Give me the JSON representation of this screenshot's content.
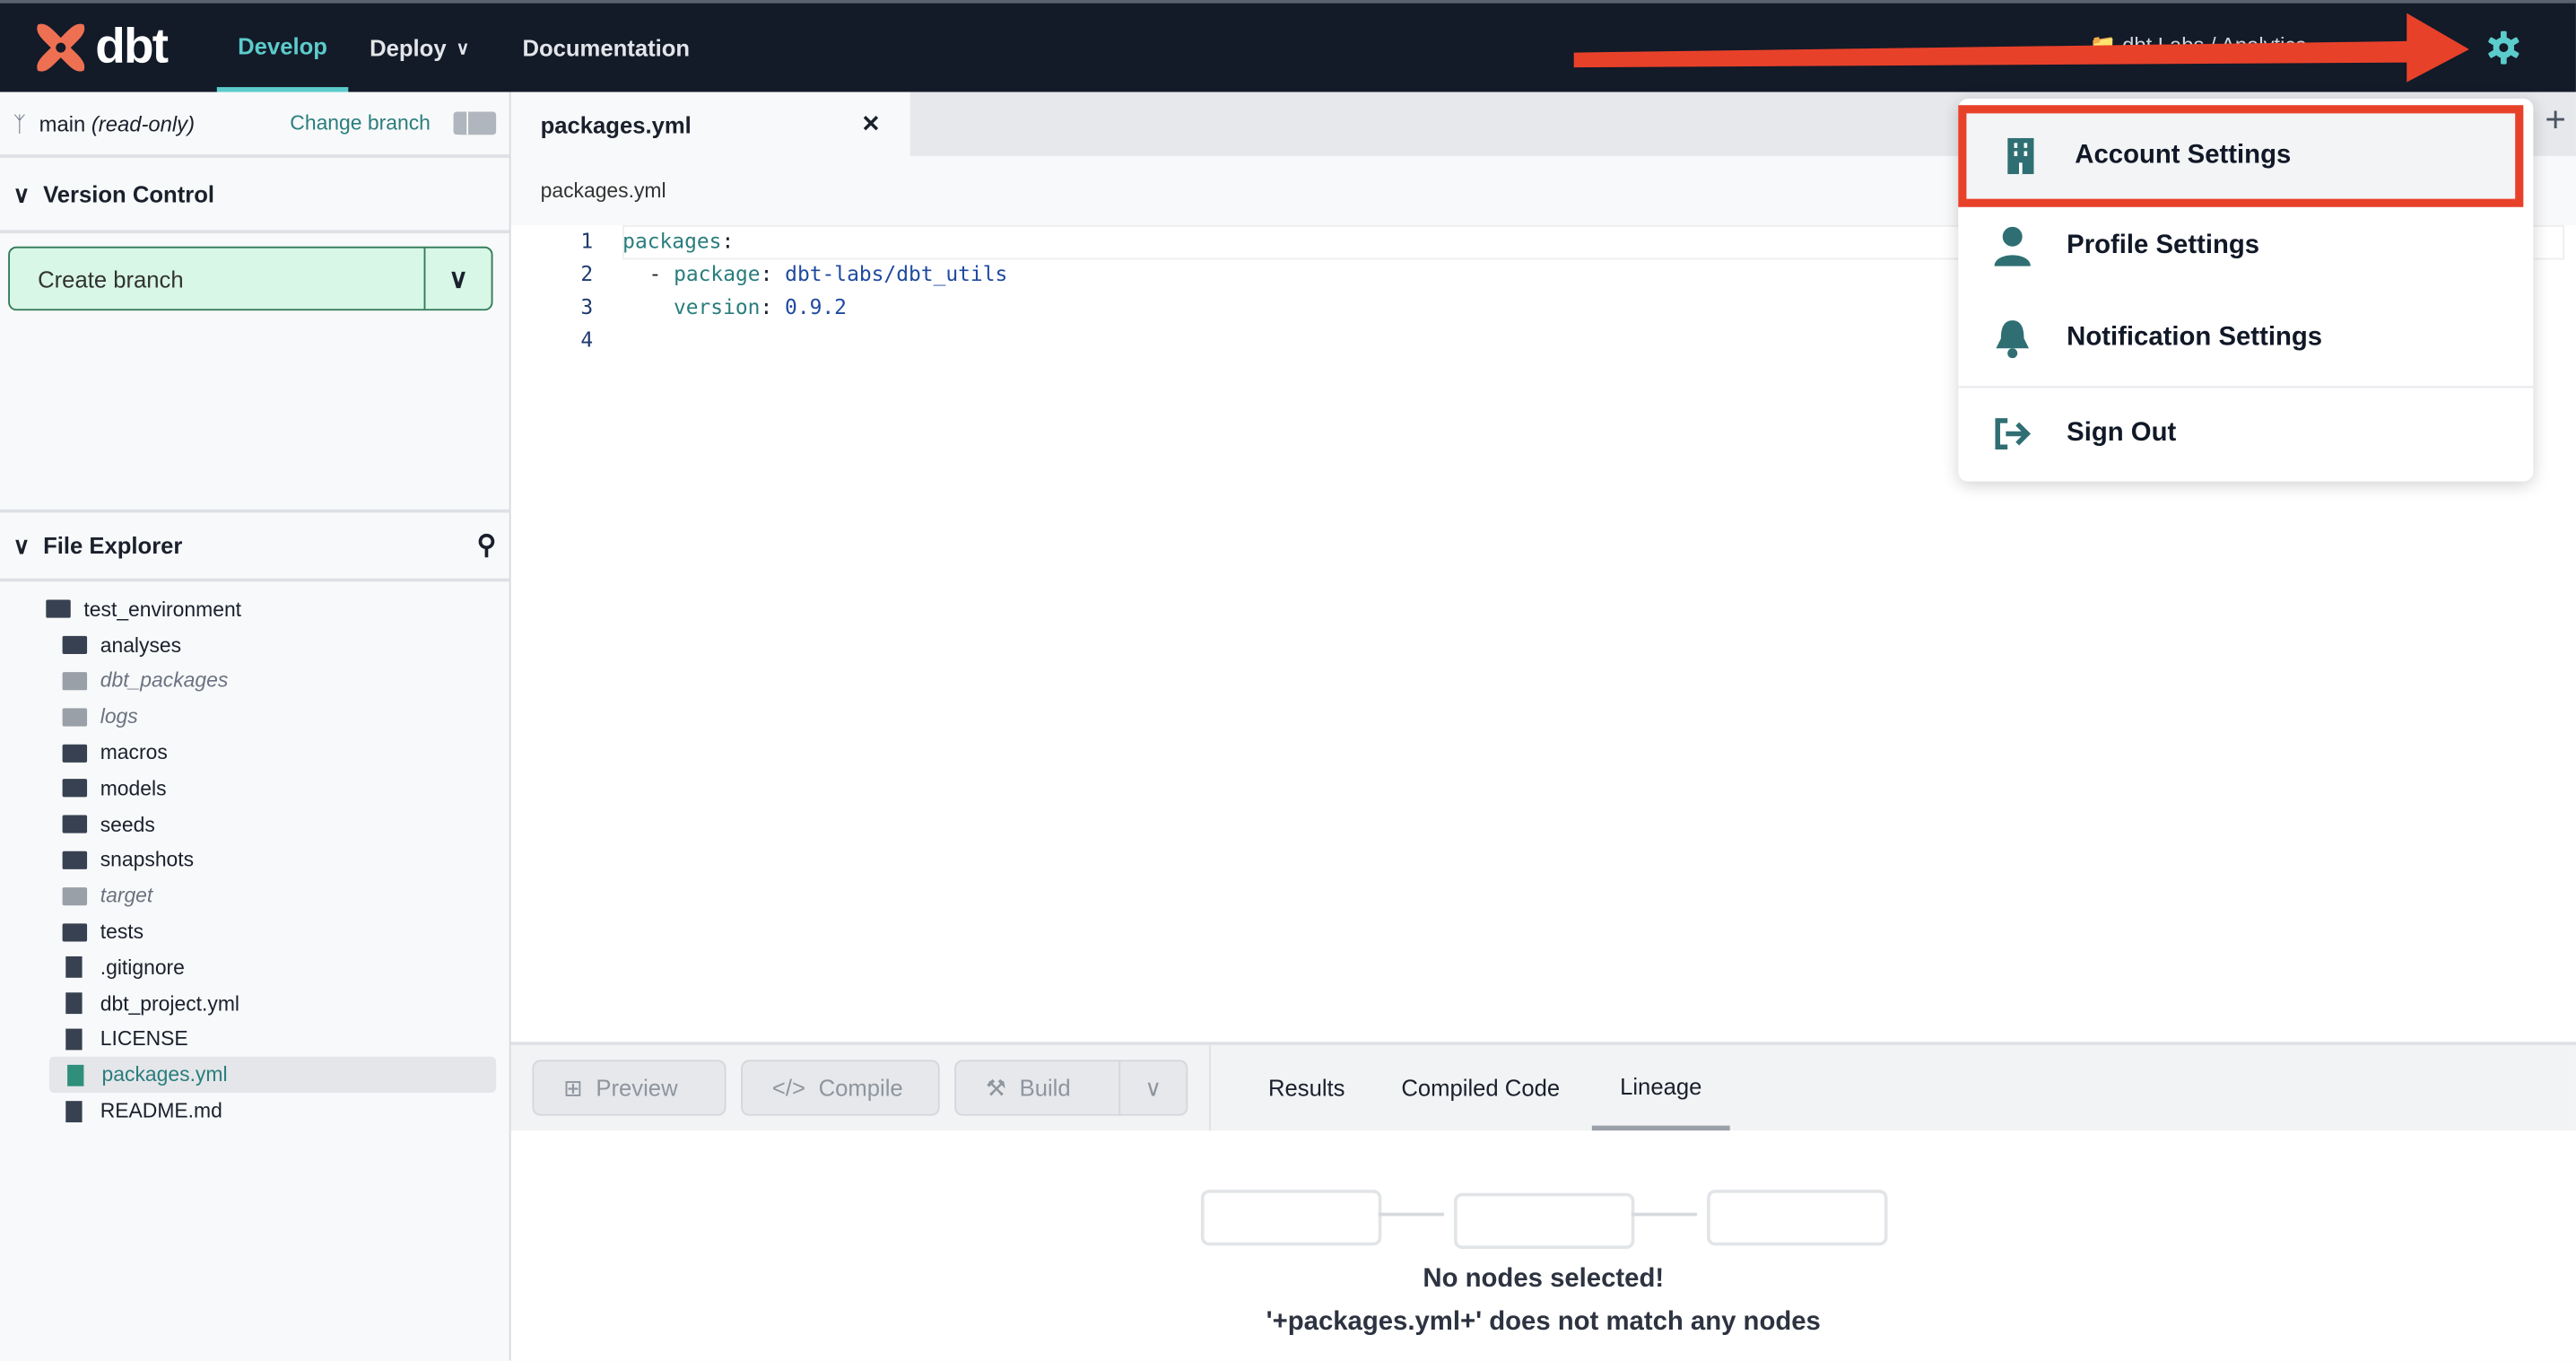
{
  "topbar": {
    "logo_text": "dbt",
    "nav": [
      {
        "label": "Develop",
        "active": true
      },
      {
        "label": "Deploy",
        "active": false
      },
      {
        "label": "Documentation",
        "active": false
      }
    ],
    "project_path": "dbt Labs / Analytics",
    "accent_color": "#5ccbcb"
  },
  "sidebar": {
    "branch": "main",
    "branch_status": "(read-only)",
    "change_branch": "Change branch",
    "version_control": "Version Control",
    "create_branch": "Create branch",
    "file_explorer": "File Explorer",
    "tree": [
      {
        "name": "test_environment",
        "type": "folder-open",
        "muted": false,
        "selected": false
      },
      {
        "name": "analyses",
        "type": "folder",
        "muted": false,
        "selected": false
      },
      {
        "name": "dbt_packages",
        "type": "folder",
        "muted": true,
        "selected": false
      },
      {
        "name": "logs",
        "type": "folder",
        "muted": true,
        "selected": false
      },
      {
        "name": "macros",
        "type": "folder",
        "muted": false,
        "selected": false
      },
      {
        "name": "models",
        "type": "folder",
        "muted": false,
        "selected": false
      },
      {
        "name": "seeds",
        "type": "folder",
        "muted": false,
        "selected": false
      },
      {
        "name": "snapshots",
        "type": "folder",
        "muted": false,
        "selected": false
      },
      {
        "name": "target",
        "type": "folder",
        "muted": true,
        "selected": false
      },
      {
        "name": "tests",
        "type": "folder",
        "muted": false,
        "selected": false
      },
      {
        "name": ".gitignore",
        "type": "file",
        "muted": false,
        "selected": false
      },
      {
        "name": "dbt_project.yml",
        "type": "file",
        "muted": false,
        "selected": false
      },
      {
        "name": "LICENSE",
        "type": "file",
        "muted": false,
        "selected": false
      },
      {
        "name": "packages.yml",
        "type": "file",
        "muted": false,
        "selected": true
      },
      {
        "name": "README.md",
        "type": "file",
        "muted": false,
        "selected": false
      }
    ]
  },
  "editor": {
    "tab": "packages.yml",
    "breadcrumb": "packages.yml",
    "lines": {
      "n1": "1",
      "n2": "2",
      "n3": "3",
      "n4": "4",
      "l1_key": "packages",
      "l1_punct": ":",
      "l2_dash": "- ",
      "l2_key": "package",
      "l2_punct": ": ",
      "l2_val": "dbt-labs/dbt_utils",
      "l3_key": "version",
      "l3_punct": ": ",
      "l3_val": "0.9.2"
    }
  },
  "bottom": {
    "preview": "Preview",
    "compile": "Compile",
    "build": "Build",
    "tabs": [
      {
        "label": "Results"
      },
      {
        "label": "Compiled Code"
      },
      {
        "label": "Lineage",
        "active": true
      }
    ],
    "empty_title": "No nodes selected!",
    "empty_msg": "'+packages.yml+' does not match any nodes"
  },
  "menu": {
    "items": [
      {
        "label": "Account Settings",
        "icon": "building-icon",
        "highlighted": true
      },
      {
        "label": "Profile Settings",
        "icon": "user-icon"
      },
      {
        "label": "Notification Settings",
        "icon": "bell-icon"
      },
      {
        "label": "Sign Out",
        "icon": "sign-out-icon"
      }
    ],
    "highlight_color": "#e8412a"
  }
}
